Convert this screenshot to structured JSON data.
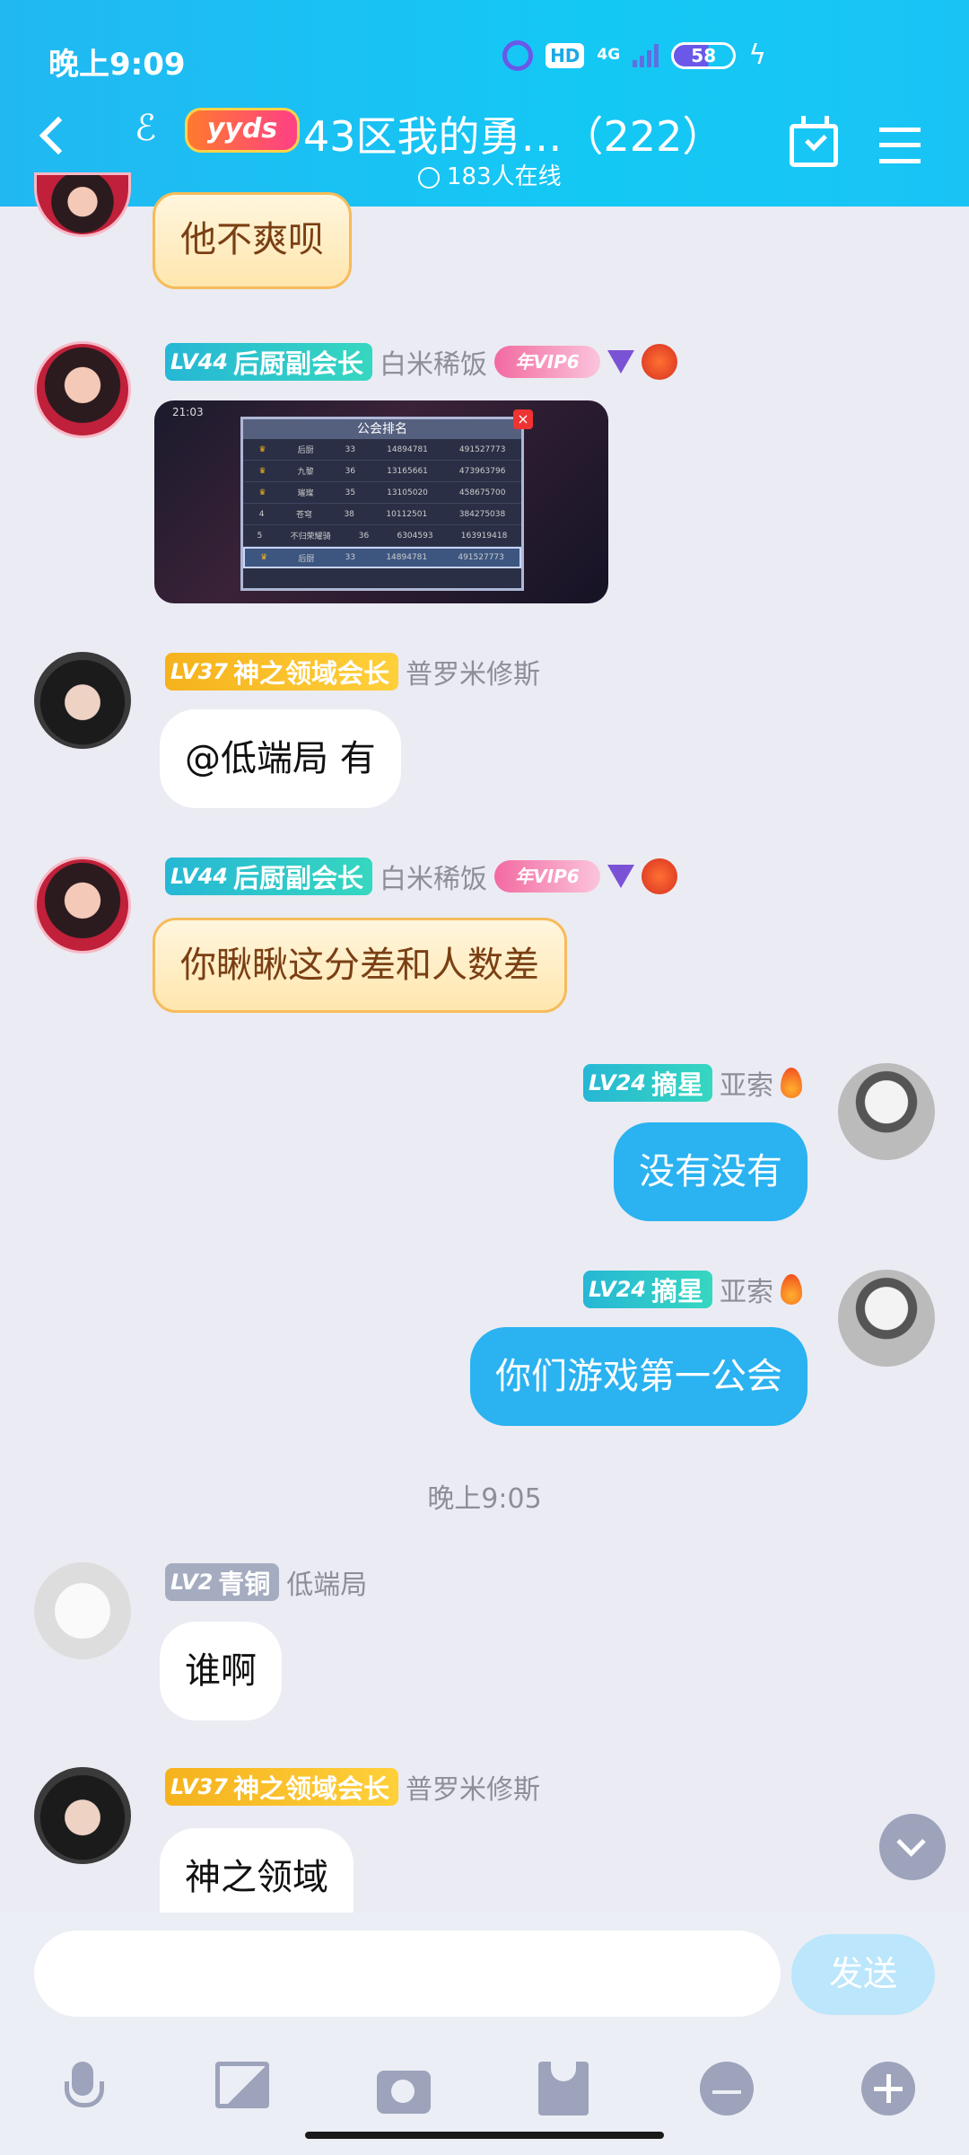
{
  "status": {
    "time": "晚上9:09",
    "hd": "HD",
    "net": "4G",
    "battery": "58"
  },
  "header": {
    "badge": "yyds",
    "title": "43区我的勇…（222）",
    "online": "183人在线"
  },
  "messages": [
    {
      "bubble": "他不爽呗"
    },
    {
      "level": "LV44",
      "role": "后厨副会长",
      "name": "白米稀饭",
      "vip": "年VIP6"
    },
    {
      "level": "LV37",
      "role": "神之领域会长",
      "name": "普罗米修斯",
      "text": "@低端局 有"
    },
    {
      "level": "LV44",
      "role": "后厨副会长",
      "name": "白米稀饭",
      "vip": "年VIP6",
      "text": "你瞅瞅这分差和人数差"
    },
    {
      "level": "LV24",
      "role": "摘星",
      "name": "亚索",
      "text": "没有没有"
    },
    {
      "level": "LV24",
      "role": "摘星",
      "name": "亚索",
      "text": "你们游戏第一公会"
    },
    {
      "level": "LV2",
      "role": "青铜",
      "name": "低端局",
      "text": "谁啊"
    },
    {
      "level": "LV37",
      "role": "神之领域会长",
      "name": "普罗米修斯",
      "text": "神之领域"
    }
  ],
  "timestamp": "晚上9:05",
  "screenshot": {
    "time": "21:03",
    "title": "公会排名",
    "rows": [
      {
        "rank": "♛",
        "name": "后厨",
        "members": "33",
        "score": "14894781",
        "total": "491527773"
      },
      {
        "rank": "♛",
        "name": "九黎",
        "members": "36",
        "score": "13165661",
        "total": "473963796"
      },
      {
        "rank": "♛",
        "name": "璀璨",
        "members": "35",
        "score": "13105020",
        "total": "458675700"
      },
      {
        "rank": "4",
        "name": "苍穹",
        "members": "38",
        "score": "10112501",
        "total": "384275038"
      },
      {
        "rank": "5",
        "name": "不归荣耀骑",
        "members": "36",
        "score": "6304593",
        "total": "163919418"
      },
      {
        "rank": "♛",
        "name": "后厨",
        "members": "33",
        "score": "14894781",
        "total": "491527773"
      }
    ]
  },
  "composer": {
    "send_label": "发送",
    "placeholder": ""
  }
}
